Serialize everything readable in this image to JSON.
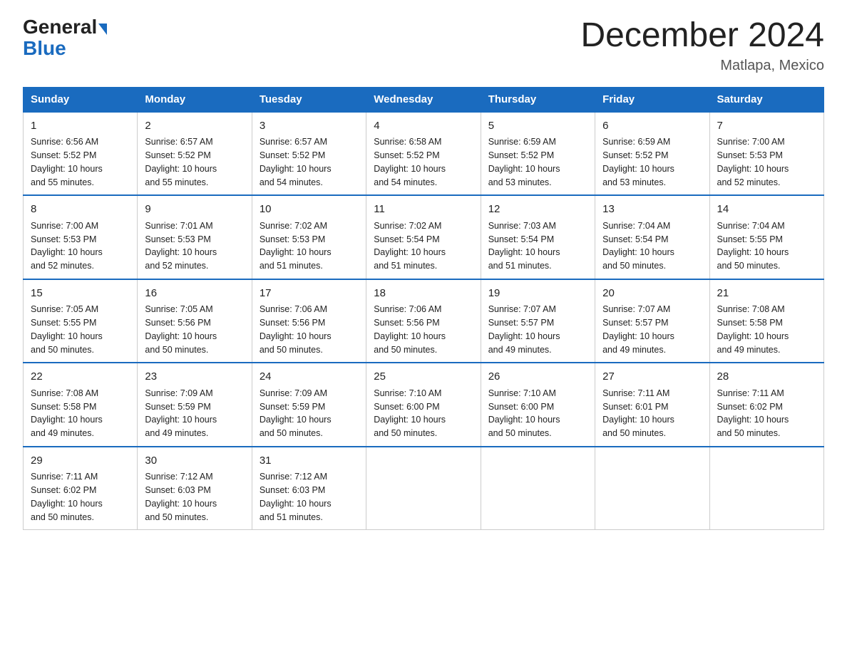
{
  "header": {
    "logo_general": "General",
    "logo_blue": "Blue",
    "month_title": "December 2024",
    "location": "Matlapa, Mexico"
  },
  "days_of_week": [
    "Sunday",
    "Monday",
    "Tuesday",
    "Wednesday",
    "Thursday",
    "Friday",
    "Saturday"
  ],
  "weeks": [
    [
      {
        "day": "1",
        "info": "Sunrise: 6:56 AM\nSunset: 5:52 PM\nDaylight: 10 hours\nand 55 minutes."
      },
      {
        "day": "2",
        "info": "Sunrise: 6:57 AM\nSunset: 5:52 PM\nDaylight: 10 hours\nand 55 minutes."
      },
      {
        "day": "3",
        "info": "Sunrise: 6:57 AM\nSunset: 5:52 PM\nDaylight: 10 hours\nand 54 minutes."
      },
      {
        "day": "4",
        "info": "Sunrise: 6:58 AM\nSunset: 5:52 PM\nDaylight: 10 hours\nand 54 minutes."
      },
      {
        "day": "5",
        "info": "Sunrise: 6:59 AM\nSunset: 5:52 PM\nDaylight: 10 hours\nand 53 minutes."
      },
      {
        "day": "6",
        "info": "Sunrise: 6:59 AM\nSunset: 5:52 PM\nDaylight: 10 hours\nand 53 minutes."
      },
      {
        "day": "7",
        "info": "Sunrise: 7:00 AM\nSunset: 5:53 PM\nDaylight: 10 hours\nand 52 minutes."
      }
    ],
    [
      {
        "day": "8",
        "info": "Sunrise: 7:00 AM\nSunset: 5:53 PM\nDaylight: 10 hours\nand 52 minutes."
      },
      {
        "day": "9",
        "info": "Sunrise: 7:01 AM\nSunset: 5:53 PM\nDaylight: 10 hours\nand 52 minutes."
      },
      {
        "day": "10",
        "info": "Sunrise: 7:02 AM\nSunset: 5:53 PM\nDaylight: 10 hours\nand 51 minutes."
      },
      {
        "day": "11",
        "info": "Sunrise: 7:02 AM\nSunset: 5:54 PM\nDaylight: 10 hours\nand 51 minutes."
      },
      {
        "day": "12",
        "info": "Sunrise: 7:03 AM\nSunset: 5:54 PM\nDaylight: 10 hours\nand 51 minutes."
      },
      {
        "day": "13",
        "info": "Sunrise: 7:04 AM\nSunset: 5:54 PM\nDaylight: 10 hours\nand 50 minutes."
      },
      {
        "day": "14",
        "info": "Sunrise: 7:04 AM\nSunset: 5:55 PM\nDaylight: 10 hours\nand 50 minutes."
      }
    ],
    [
      {
        "day": "15",
        "info": "Sunrise: 7:05 AM\nSunset: 5:55 PM\nDaylight: 10 hours\nand 50 minutes."
      },
      {
        "day": "16",
        "info": "Sunrise: 7:05 AM\nSunset: 5:56 PM\nDaylight: 10 hours\nand 50 minutes."
      },
      {
        "day": "17",
        "info": "Sunrise: 7:06 AM\nSunset: 5:56 PM\nDaylight: 10 hours\nand 50 minutes."
      },
      {
        "day": "18",
        "info": "Sunrise: 7:06 AM\nSunset: 5:56 PM\nDaylight: 10 hours\nand 50 minutes."
      },
      {
        "day": "19",
        "info": "Sunrise: 7:07 AM\nSunset: 5:57 PM\nDaylight: 10 hours\nand 49 minutes."
      },
      {
        "day": "20",
        "info": "Sunrise: 7:07 AM\nSunset: 5:57 PM\nDaylight: 10 hours\nand 49 minutes."
      },
      {
        "day": "21",
        "info": "Sunrise: 7:08 AM\nSunset: 5:58 PM\nDaylight: 10 hours\nand 49 minutes."
      }
    ],
    [
      {
        "day": "22",
        "info": "Sunrise: 7:08 AM\nSunset: 5:58 PM\nDaylight: 10 hours\nand 49 minutes."
      },
      {
        "day": "23",
        "info": "Sunrise: 7:09 AM\nSunset: 5:59 PM\nDaylight: 10 hours\nand 49 minutes."
      },
      {
        "day": "24",
        "info": "Sunrise: 7:09 AM\nSunset: 5:59 PM\nDaylight: 10 hours\nand 50 minutes."
      },
      {
        "day": "25",
        "info": "Sunrise: 7:10 AM\nSunset: 6:00 PM\nDaylight: 10 hours\nand 50 minutes."
      },
      {
        "day": "26",
        "info": "Sunrise: 7:10 AM\nSunset: 6:00 PM\nDaylight: 10 hours\nand 50 minutes."
      },
      {
        "day": "27",
        "info": "Sunrise: 7:11 AM\nSunset: 6:01 PM\nDaylight: 10 hours\nand 50 minutes."
      },
      {
        "day": "28",
        "info": "Sunrise: 7:11 AM\nSunset: 6:02 PM\nDaylight: 10 hours\nand 50 minutes."
      }
    ],
    [
      {
        "day": "29",
        "info": "Sunrise: 7:11 AM\nSunset: 6:02 PM\nDaylight: 10 hours\nand 50 minutes."
      },
      {
        "day": "30",
        "info": "Sunrise: 7:12 AM\nSunset: 6:03 PM\nDaylight: 10 hours\nand 50 minutes."
      },
      {
        "day": "31",
        "info": "Sunrise: 7:12 AM\nSunset: 6:03 PM\nDaylight: 10 hours\nand 51 minutes."
      },
      {
        "day": "",
        "info": ""
      },
      {
        "day": "",
        "info": ""
      },
      {
        "day": "",
        "info": ""
      },
      {
        "day": "",
        "info": ""
      }
    ]
  ]
}
